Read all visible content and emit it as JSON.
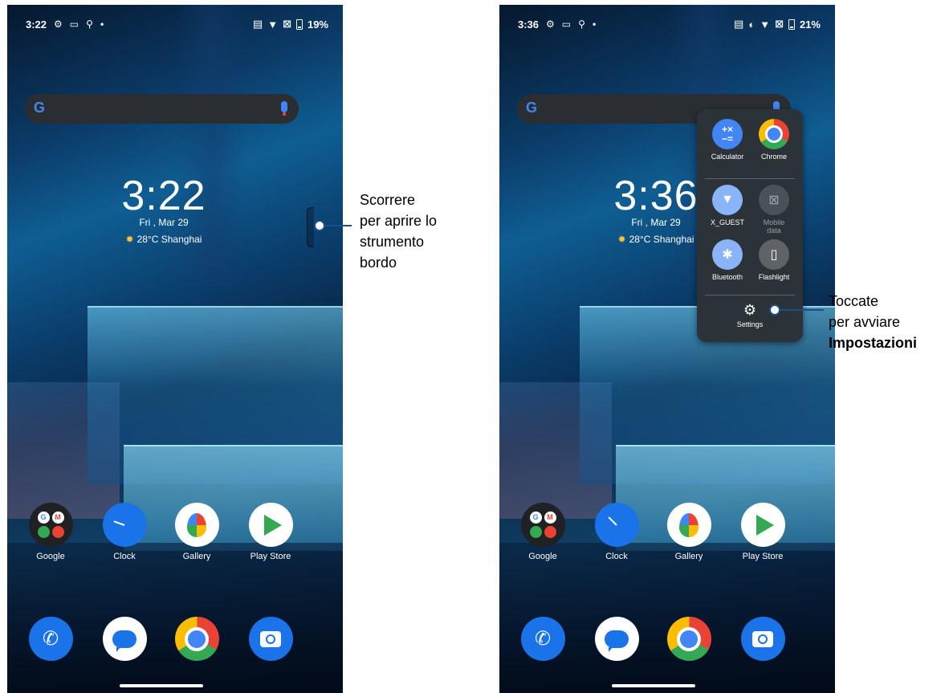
{
  "left": {
    "status": {
      "time": "3:22",
      "battery": "19%"
    },
    "clock": {
      "time": "3:22",
      "date": "Fri , Mar 29",
      "weather": "28°C Shanghai"
    },
    "apps": [
      "Google",
      "Clock",
      "Gallery",
      "Play Store"
    ],
    "callout": {
      "line1": "Scorrere",
      "line2": "per aprire lo",
      "line3": "strumento",
      "line4": "bordo"
    }
  },
  "right": {
    "status": {
      "time": "3:36",
      "battery": "21%"
    },
    "clock": {
      "time": "3:36",
      "date": "Fri , Mar 29",
      "weather": "28°C Shanghai"
    },
    "apps": [
      "Google",
      "Clock",
      "Gallery",
      "Play Store"
    ],
    "panel": {
      "calculator": "Calculator",
      "chrome": "Chrome",
      "wifi": "X_GUEST",
      "mobile_data_1": "Mobile",
      "mobile_data_2": "data",
      "bluetooth": "Bluetooth",
      "flashlight": "Flashlight",
      "settings": "Settings"
    },
    "callout": {
      "line1": "Toccate",
      "line2": "per avviare",
      "line3": "Impostazioni"
    }
  },
  "icons": [
    "settings-gear-icon",
    "gallery-icon",
    "location-icon",
    "wifi-icon",
    "no-sim-icon",
    "battery-icon",
    "google-g-icon",
    "mic-icon",
    "sun-icon",
    "phone-icon",
    "messages-icon",
    "chrome-icon",
    "camera-icon",
    "calculator-icon",
    "bluetooth-icon",
    "flashlight-icon"
  ],
  "colors": {
    "accent": "#1a73e8",
    "callout_line": "#1b4f8a",
    "panel_bg": "#2b3238"
  }
}
